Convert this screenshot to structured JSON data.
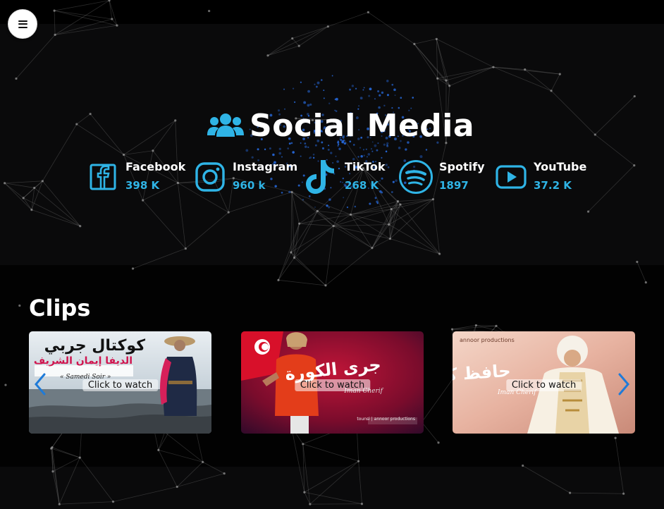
{
  "menu": {
    "icon": "hamburger-menu-icon"
  },
  "social": {
    "title": "Social Media",
    "title_icon": "users-icon",
    "accent_color": "#2fb4e6",
    "items": [
      {
        "name": "Facebook",
        "count": "398 K",
        "icon": "facebook-icon"
      },
      {
        "name": "Instagram",
        "count": "960 k",
        "icon": "instagram-icon"
      },
      {
        "name": "TikTok",
        "count": "268 K",
        "icon": "tiktok-icon"
      },
      {
        "name": "Spotify",
        "count": "1897",
        "icon": "spotify-icon"
      },
      {
        "name": "YouTube",
        "count": "37.2 K",
        "icon": "youtube-icon"
      }
    ]
  },
  "clips": {
    "title": "Clips",
    "watch_label": "Click to watch",
    "items": [
      {
        "title_ar": "كوكتال جربي",
        "subtitle_ar": "الديفا إيمان الشريف",
        "caption": "« Samedi Soir »"
      },
      {
        "title_ar": "جرى الكورة",
        "caption": "Iman Cherif",
        "logo": "tounsi | annoor productions"
      },
      {
        "title_ar": "حافظ كبير",
        "caption": "Iman Cherif",
        "logo": "annoor productions"
      }
    ],
    "prev_icon": "chevron-left-icon",
    "next_icon": "chevron-right-icon"
  }
}
